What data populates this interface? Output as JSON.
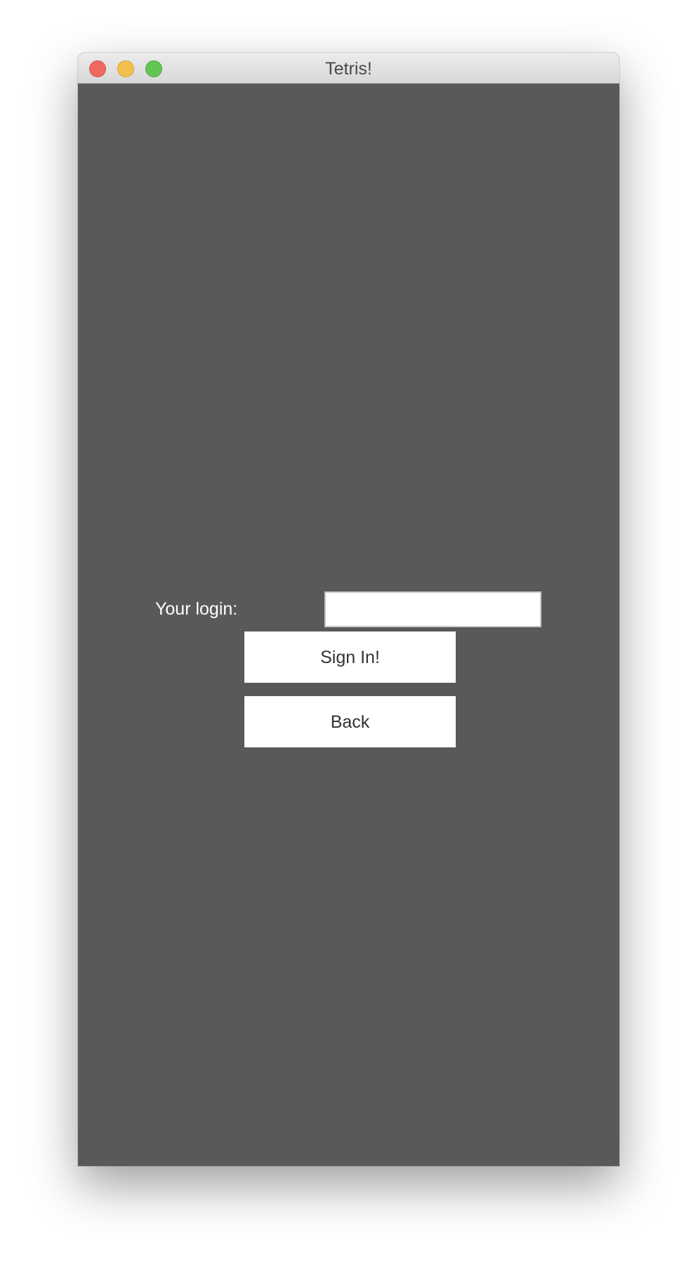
{
  "window": {
    "title": "Tetris!"
  },
  "login": {
    "label": "Your login:",
    "value": "",
    "placeholder": ""
  },
  "buttons": {
    "sign_in_label": "Sign In!",
    "back_label": "Back"
  },
  "colors": {
    "content_background": "#595959",
    "close_button": "#ee6a5e",
    "minimize_button": "#f5bf4f",
    "zoom_button": "#62c554"
  }
}
